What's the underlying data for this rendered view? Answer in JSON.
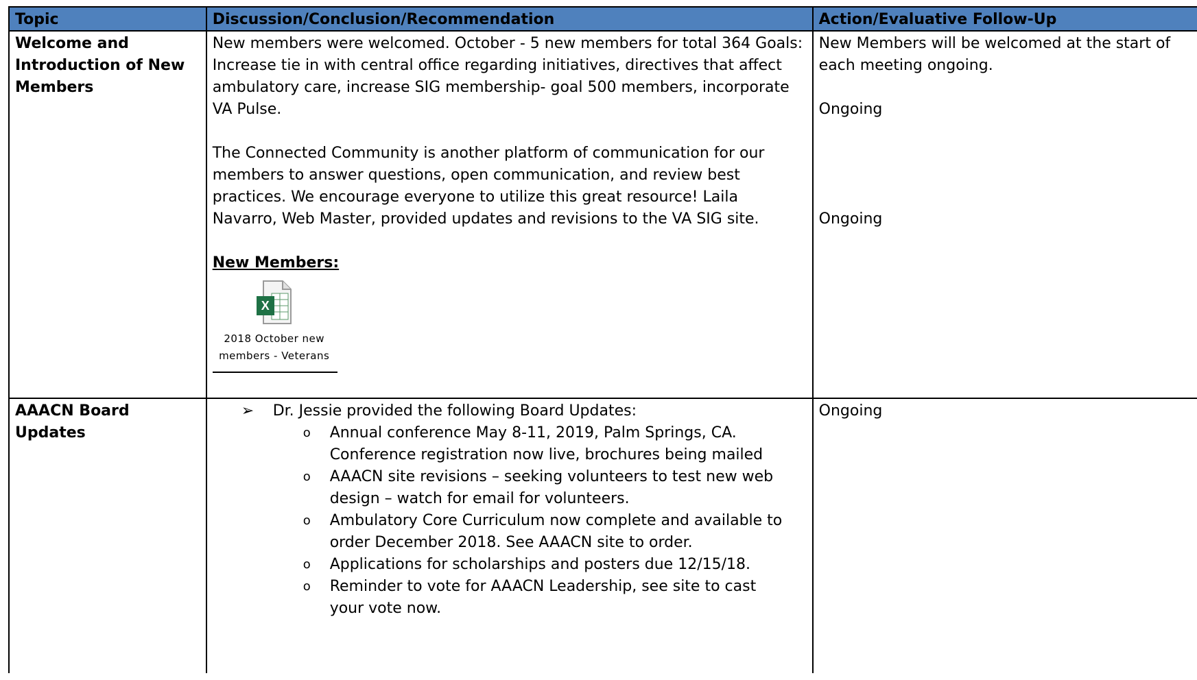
{
  "headers": [
    "Topic",
    "Discussion/Conclusion/Recommendation",
    "Action/Evaluative Follow-Up"
  ],
  "colors": {
    "header_bg": "#4f81bd",
    "excel_green": "#1e7145"
  },
  "row1": {
    "topic": "Welcome and Introduction of New Members",
    "para1": "New members were welcomed. October - 5 new members for total 364 Goals: Increase tie in with central office regarding initiatives, directives that affect ambulatory care, increase SIG membership- goal 500 members, incorporate VA Pulse.",
    "para2": "The Connected Community is another platform of communication for our members to answer questions, open communication, and review best practices. We encourage everyone to utilize this great resource!  Laila Navarro, Web Master, provided updates and revisions to the VA SIG site.",
    "new_members_heading": "New Members:",
    "attachment": {
      "icon": "excel-file-icon",
      "caption": "2018 October new members -  Veterans"
    },
    "action1": "New Members will be welcomed at the start of each meeting ongoing.",
    "action2": "Ongoing",
    "action3": "Ongoing"
  },
  "row2": {
    "topic": "AAACN Board Updates",
    "bullet_symbol": "➢",
    "bullet": "Dr. Jessie provided the following Board Updates:",
    "sub_symbol": "o",
    "sub_items": [
      "Annual conference May 8-11, 2019, Palm Springs, CA. Conference registration now live, brochures being mailed",
      "AAACN site revisions – seeking volunteers to test new web design – watch for email for volunteers.",
      "Ambulatory Core Curriculum now complete and available to order December 2018.  See AAACN site to order.",
      "Applications for scholarships and posters due 12/15/18.",
      "Reminder to vote for AAACN Leadership, see site to cast your vote now."
    ],
    "action": "Ongoing"
  }
}
